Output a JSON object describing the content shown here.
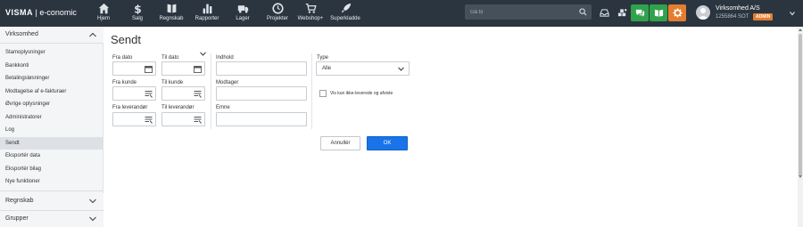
{
  "brand": {
    "logo": "VISMA",
    "product": "e-conomic"
  },
  "nav": [
    {
      "label": "Hjem",
      "icon": "home-icon"
    },
    {
      "label": "Salg",
      "icon": "dollar-icon"
    },
    {
      "label": "Regnskab",
      "icon": "book-icon"
    },
    {
      "label": "Rapporter",
      "icon": "bar-chart-icon"
    },
    {
      "label": "Lager",
      "icon": "truck-icon"
    },
    {
      "label": "Projekter",
      "icon": "clock-icon"
    },
    {
      "label": "Webshop+",
      "icon": "cart-icon"
    },
    {
      "label": "Superkladde",
      "icon": "rocket-icon"
    }
  ],
  "search": {
    "placeholder": "Gå til"
  },
  "account": {
    "company": "Virksomhed A/S",
    "id": "1255864 SOT",
    "badge": "ADMIN"
  },
  "colors": {
    "topbar": "#2b3540",
    "accent_green": "#31a24c",
    "accent_orange": "#e47d2e",
    "ok_blue": "#1a73e8"
  },
  "sidebar": {
    "section1": "Virksomhed",
    "items": [
      "Stamoplysninger",
      "Bankkonti",
      "Betalingsløsninger",
      "Modtagelse af e-fakturaer",
      "Øvrige oplysninger",
      "Administratorer",
      "Log",
      "Sendt",
      "Eksportér data",
      "Eksportér bilag",
      "Nye funktioner"
    ],
    "active_item": "Sendt",
    "section2": "Regnskab",
    "section3": "Grupper"
  },
  "page": {
    "title": "Sendt",
    "labels": {
      "fra_dato": "Fra dato",
      "til_dato": "Til dato",
      "fra_kunde": "Fra kunde",
      "til_kunde": "Til kunde",
      "fra_leverandor": "Fra leverandør",
      "til_leverandor": "Til leverandør",
      "indhold": "Indhold",
      "modtager": "Modtager",
      "emne": "Emne",
      "type": "Type"
    },
    "type_selected": "Alle",
    "checkbox_label": "Vis kun ikke-leverede og afviste",
    "cancel": "Annullér",
    "ok": "OK"
  }
}
